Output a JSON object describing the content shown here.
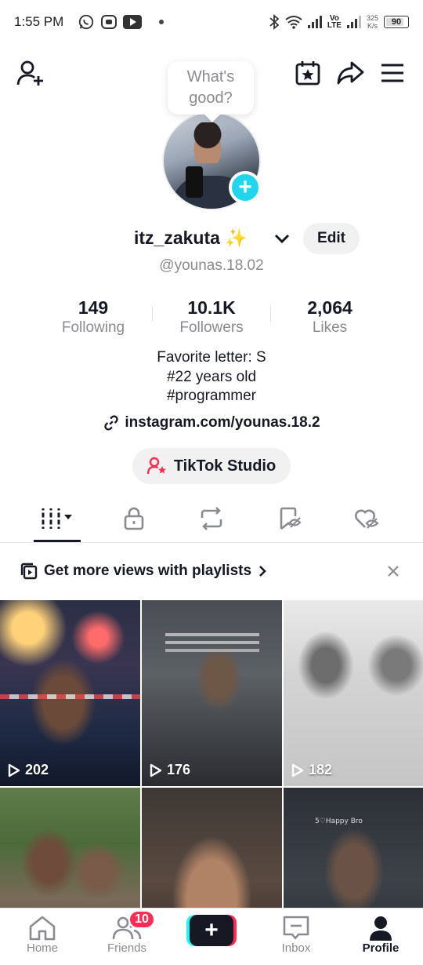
{
  "status_bar": {
    "time": "1:55 PM",
    "network_speed_value": "325",
    "network_speed_unit": "K/s",
    "battery": "90",
    "volte_top": "Vo",
    "volte_bottom": "LTE"
  },
  "profile": {
    "bubble_text": "What's good?",
    "username": "itz_zakuta ✨",
    "handle": "@younas.18.02",
    "edit_label": "Edit"
  },
  "stats": {
    "following": {
      "value": "149",
      "label": "Following"
    },
    "followers": {
      "value": "10.1K",
      "label": "Followers"
    },
    "likes": {
      "value": "2,064",
      "label": "Likes"
    }
  },
  "bio": {
    "line1": "Favorite letter: S",
    "line2": "#22 years old",
    "line3": "#programmer",
    "link": "instagram.com/younas.18.2"
  },
  "studio_button": "TikTok Studio",
  "playlist_banner": "Get more views with playlists",
  "videos": [
    {
      "views": "202"
    },
    {
      "views": "176"
    },
    {
      "views": "182"
    },
    {
      "views": ""
    },
    {
      "views": ""
    },
    {
      "views": "",
      "caption": "5♡Happy Bro"
    }
  ],
  "nav": {
    "home": "Home",
    "friends": "Friends",
    "friends_badge": "10",
    "inbox": "Inbox",
    "profile": "Profile"
  },
  "colors": {
    "accent_pink": "#fe2c55",
    "accent_cyan": "#20d5ec",
    "text_primary": "#161823",
    "text_secondary": "#8a8b91"
  }
}
